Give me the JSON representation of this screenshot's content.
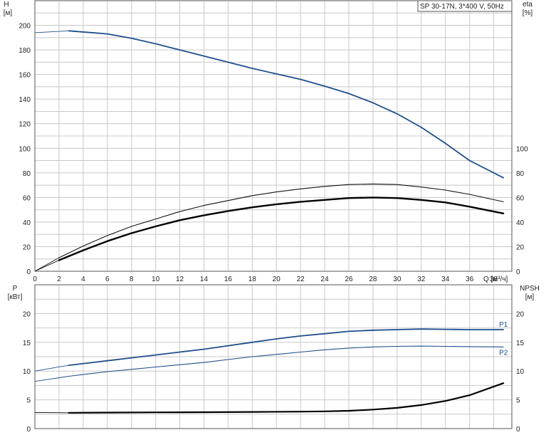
{
  "chart_data": [
    {
      "type": "line",
      "title": "SP 30-17N, 3*400 V, 50Hz",
      "xlabel": "Q [м³/ч]",
      "xlim": [
        0,
        39.5
      ],
      "x_ticks": [
        0,
        2,
        4,
        6,
        8,
        10,
        12,
        14,
        16,
        18,
        20,
        22,
        24,
        26,
        28,
        30,
        32,
        34,
        36,
        38
      ],
      "ylabel_left": [
        "H",
        "[м]"
      ],
      "ylim_left": [
        0,
        220
      ],
      "y_ticks_left": [
        0,
        20,
        40,
        60,
        80,
        100,
        120,
        140,
        160,
        180,
        200
      ],
      "ylabel_right": [
        "eta",
        "[%]"
      ],
      "ylim_right": [
        0,
        220
      ],
      "y_ticks_right": [
        0,
        20,
        40,
        60,
        80,
        100
      ],
      "grid": true,
      "series": [
        {
          "name": "H",
          "axis": "left",
          "color": "#1f4e8c",
          "points": [
            [
              0,
              194
            ],
            [
              2.8,
              195.5
            ],
            [
              6,
              193
            ],
            [
              8,
              189.5
            ],
            [
              10,
              185
            ],
            [
              12,
              180
            ],
            [
              14,
              175
            ],
            [
              16,
              170
            ],
            [
              18,
              165
            ],
            [
              20,
              160.5
            ],
            [
              22,
              156
            ],
            [
              24,
              150.5
            ],
            [
              26,
              144.5
            ],
            [
              28,
              137
            ],
            [
              30,
              128
            ],
            [
              32,
              117
            ],
            [
              34,
              104
            ],
            [
              36,
              90
            ],
            [
              38.8,
              76
            ]
          ]
        },
        {
          "name": "",
          "axis": "right",
          "color": "#111111",
          "points": [
            [
              0,
              0
            ],
            [
              2,
              11
            ],
            [
              4,
              20.5
            ],
            [
              6,
              29
            ],
            [
              8,
              36.5
            ],
            [
              10,
              42.5
            ],
            [
              12,
              48.5
            ],
            [
              14,
              53.5
            ],
            [
              16,
              57.5
            ],
            [
              18,
              61.5
            ],
            [
              20,
              64.5
            ],
            [
              22,
              67
            ],
            [
              24,
              69
            ],
            [
              26,
              70.5
            ],
            [
              28,
              71
            ],
            [
              30,
              70.5
            ],
            [
              32,
              68.5
            ],
            [
              34,
              66
            ],
            [
              36,
              62.5
            ],
            [
              38.8,
              56.5
            ]
          ]
        },
        {
          "name": "",
          "axis": "right",
          "color": "#000000",
          "points": [
            [
              0,
              0
            ],
            [
              2,
              9
            ],
            [
              4,
              17
            ],
            [
              6,
              24.5
            ],
            [
              8,
              31
            ],
            [
              10,
              36.5
            ],
            [
              12,
              41.5
            ],
            [
              14,
              45.5
            ],
            [
              16,
              49
            ],
            [
              18,
              52
            ],
            [
              20,
              54.5
            ],
            [
              22,
              56.5
            ],
            [
              24,
              58
            ],
            [
              26,
              59.5
            ],
            [
              28,
              60
            ],
            [
              30,
              59.5
            ],
            [
              32,
              58
            ],
            [
              34,
              56
            ],
            [
              36,
              52.5
            ],
            [
              38.8,
              47
            ]
          ]
        }
      ]
    },
    {
      "type": "line",
      "xlim": [
        0,
        39.5
      ],
      "ylabel_left": [
        "P",
        "[кВт]"
      ],
      "ylim_left": [
        0,
        25
      ],
      "y_ticks_left": [
        0,
        5,
        10,
        15,
        20
      ],
      "ylabel_right": [
        "NPSH",
        "[м]"
      ],
      "ylim_right": [
        0,
        25
      ],
      "y_ticks_right": [
        0,
        5,
        10,
        15,
        20
      ],
      "grid": true,
      "series": [
        {
          "name": "P1",
          "axis": "left",
          "color": "#1f4e8c",
          "points": [
            [
              0,
              10
            ],
            [
              2.8,
              11
            ],
            [
              6,
              11.8
            ],
            [
              8,
              12.3
            ],
            [
              10,
              12.8
            ],
            [
              12,
              13.3
            ],
            [
              14,
              13.8
            ],
            [
              16,
              14.4
            ],
            [
              18,
              15
            ],
            [
              20,
              15.6
            ],
            [
              22,
              16.1
            ],
            [
              24,
              16.5
            ],
            [
              26,
              16.9
            ],
            [
              28,
              17.1
            ],
            [
              30,
              17.2
            ],
            [
              32,
              17.3
            ],
            [
              34,
              17.25
            ],
            [
              36,
              17.2
            ],
            [
              38.8,
              17.2
            ]
          ]
        },
        {
          "name": "P2",
          "axis": "left",
          "color": "#1f4e8c",
          "points": [
            [
              0,
              8.2
            ],
            [
              2.8,
              9.1
            ],
            [
              6,
              9.9
            ],
            [
              8,
              10.3
            ],
            [
              10,
              10.7
            ],
            [
              12,
              11.1
            ],
            [
              14,
              11.5
            ],
            [
              16,
              12
            ],
            [
              18,
              12.5
            ],
            [
              20,
              12.9
            ],
            [
              22,
              13.3
            ],
            [
              24,
              13.7
            ],
            [
              26,
              14
            ],
            [
              28,
              14.2
            ],
            [
              30,
              14.3
            ],
            [
              32,
              14.35
            ],
            [
              34,
              14.3
            ],
            [
              36,
              14.25
            ],
            [
              38.8,
              14.2
            ]
          ]
        },
        {
          "name": "",
          "axis": "right",
          "color": "#000000",
          "points": [
            [
              0,
              2.8
            ],
            [
              2.8,
              2.75
            ],
            [
              6,
              2.78
            ],
            [
              10,
              2.82
            ],
            [
              14,
              2.85
            ],
            [
              18,
              2.9
            ],
            [
              22,
              2.95
            ],
            [
              24,
              3
            ],
            [
              26,
              3.1
            ],
            [
              28,
              3.3
            ],
            [
              30,
              3.6
            ],
            [
              32,
              4.1
            ],
            [
              34,
              4.8
            ],
            [
              36,
              5.8
            ],
            [
              38.8,
              7.9
            ]
          ]
        }
      ]
    }
  ]
}
